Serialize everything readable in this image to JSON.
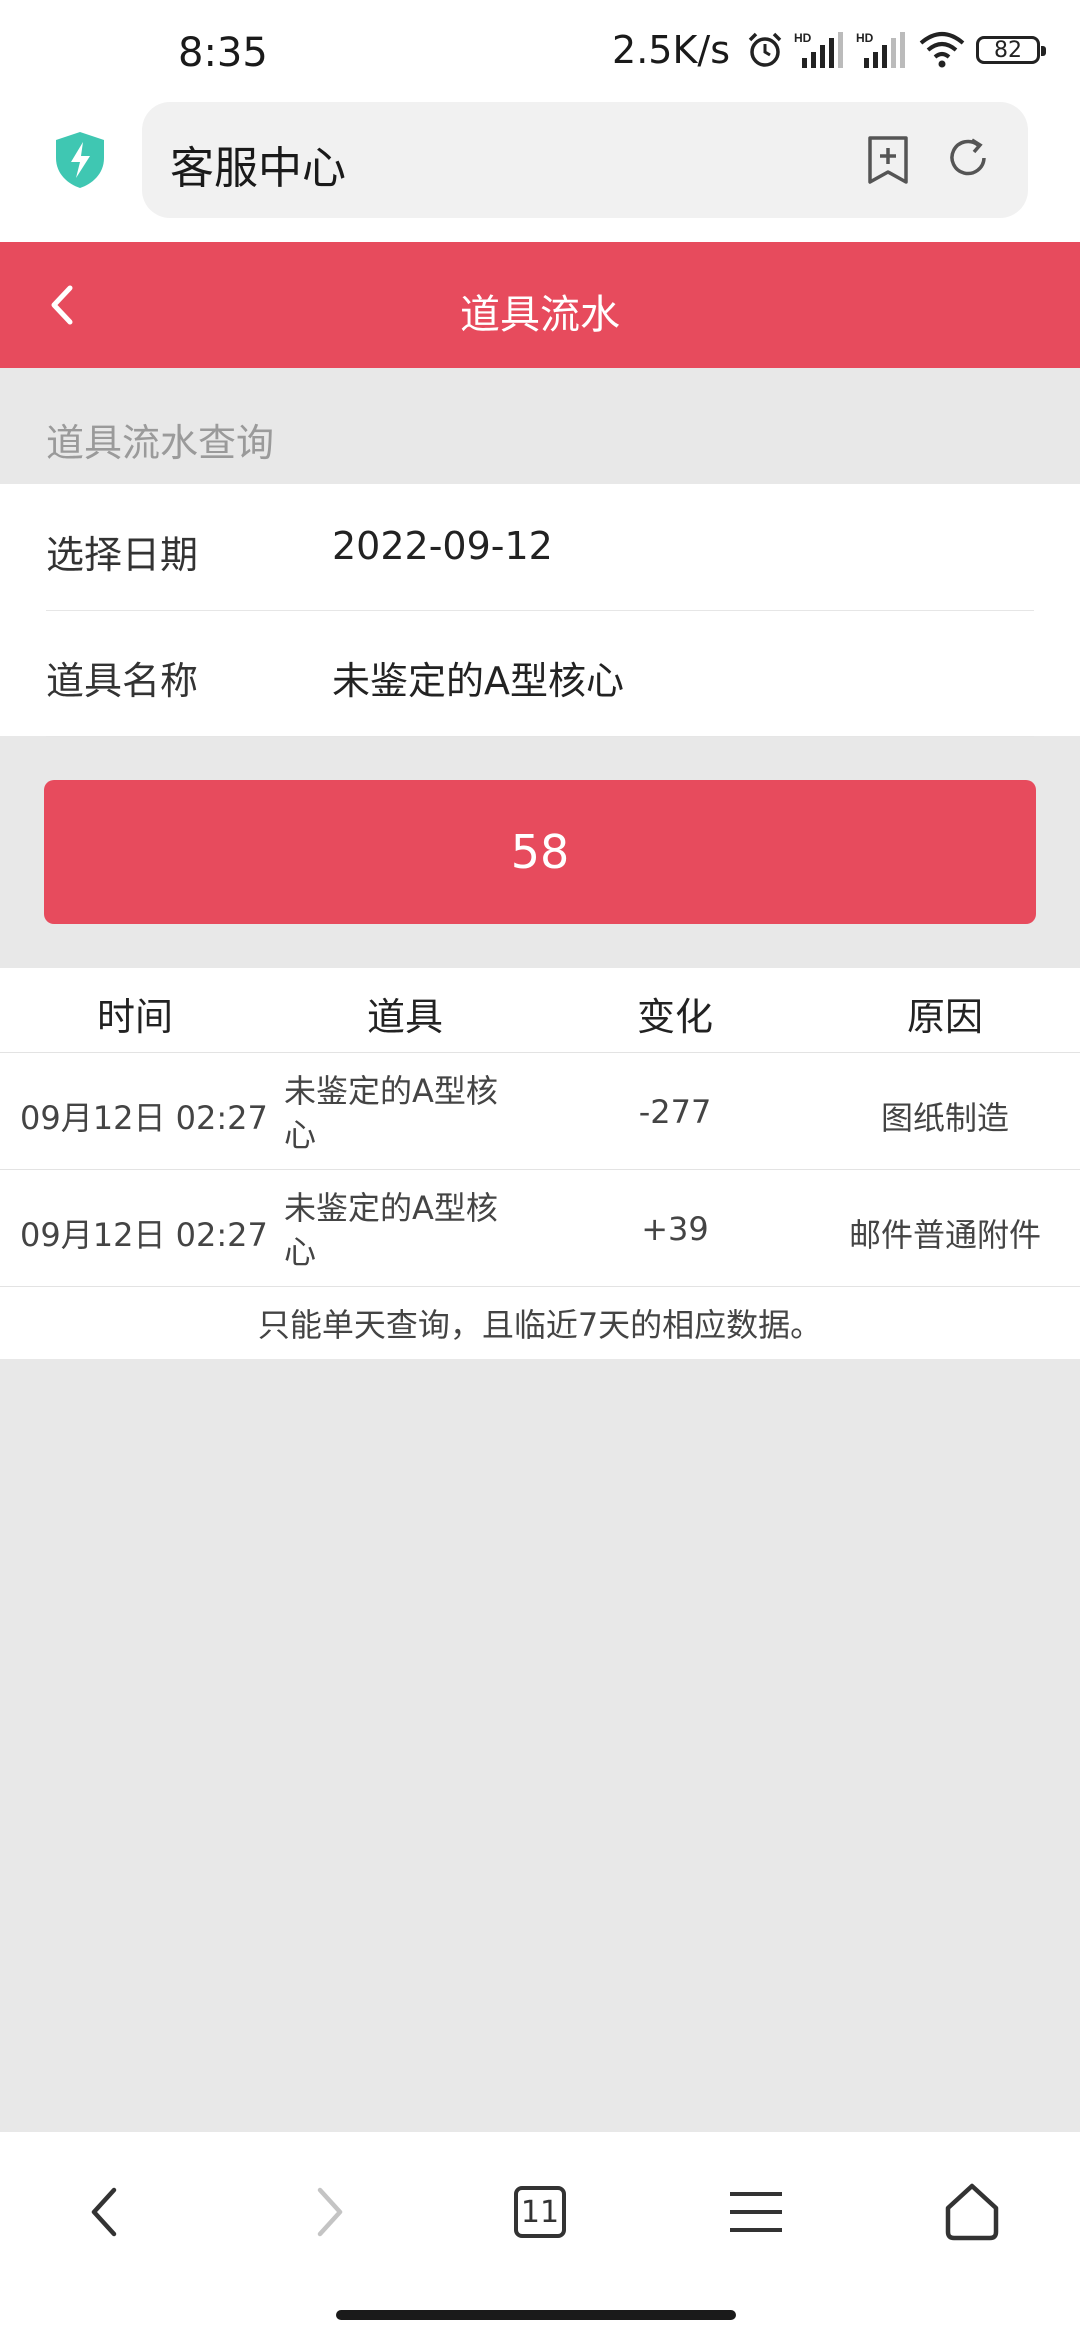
{
  "status_bar": {
    "time": "8:35",
    "net_speed": "2.5K/s",
    "battery": "82",
    "icons": [
      "alarm-icon",
      "signal-hd-icon",
      "signal-hd-icon",
      "wifi-icon",
      "battery-icon"
    ]
  },
  "browser": {
    "url_text": "客服中心",
    "icons": [
      "shield-icon",
      "bookmark-add-icon",
      "reload-icon"
    ]
  },
  "header": {
    "title": "道具流水",
    "accent": "#e74b5d"
  },
  "section": {
    "label": "道具流水查询"
  },
  "form": {
    "date_label": "选择日期",
    "date_value": "2022-09-12",
    "item_label": "道具名称",
    "item_value": "未鉴定的A型核心"
  },
  "submit": {
    "label": "58"
  },
  "table": {
    "headers": [
      "时间",
      "道具",
      "变化",
      "原因"
    ],
    "rows": [
      {
        "time": "09月12日 02:27",
        "item": "未鉴定的A型核心",
        "change": "-277",
        "reason": "图纸制造"
      },
      {
        "time": "09月12日 02:27",
        "item": "未鉴定的A型核心",
        "change": "+39",
        "reason": "邮件普通附件"
      }
    ],
    "note": "只能单天查询，且临近7天的相应数据。"
  },
  "bottom_nav": {
    "tab_count": "11",
    "icons": [
      "back-icon",
      "forward-icon",
      "tabs-icon",
      "menu-icon",
      "home-icon"
    ]
  }
}
